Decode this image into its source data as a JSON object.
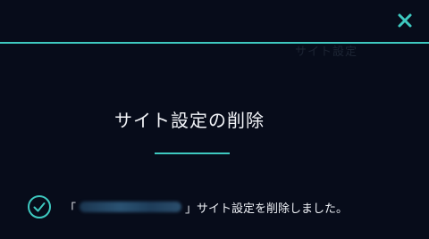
{
  "dialog": {
    "background_text": "サイト設定",
    "title": "サイト設定の削除",
    "message": {
      "open_bracket": "「",
      "close_bracket": "」",
      "suffix": "サイト設定を削除しました。"
    }
  },
  "icons": {
    "close": "close-icon",
    "success": "check-circle-icon"
  },
  "colors": {
    "background": "#060b18",
    "accent": "#3ec9c0",
    "text": "#eef1f6"
  }
}
